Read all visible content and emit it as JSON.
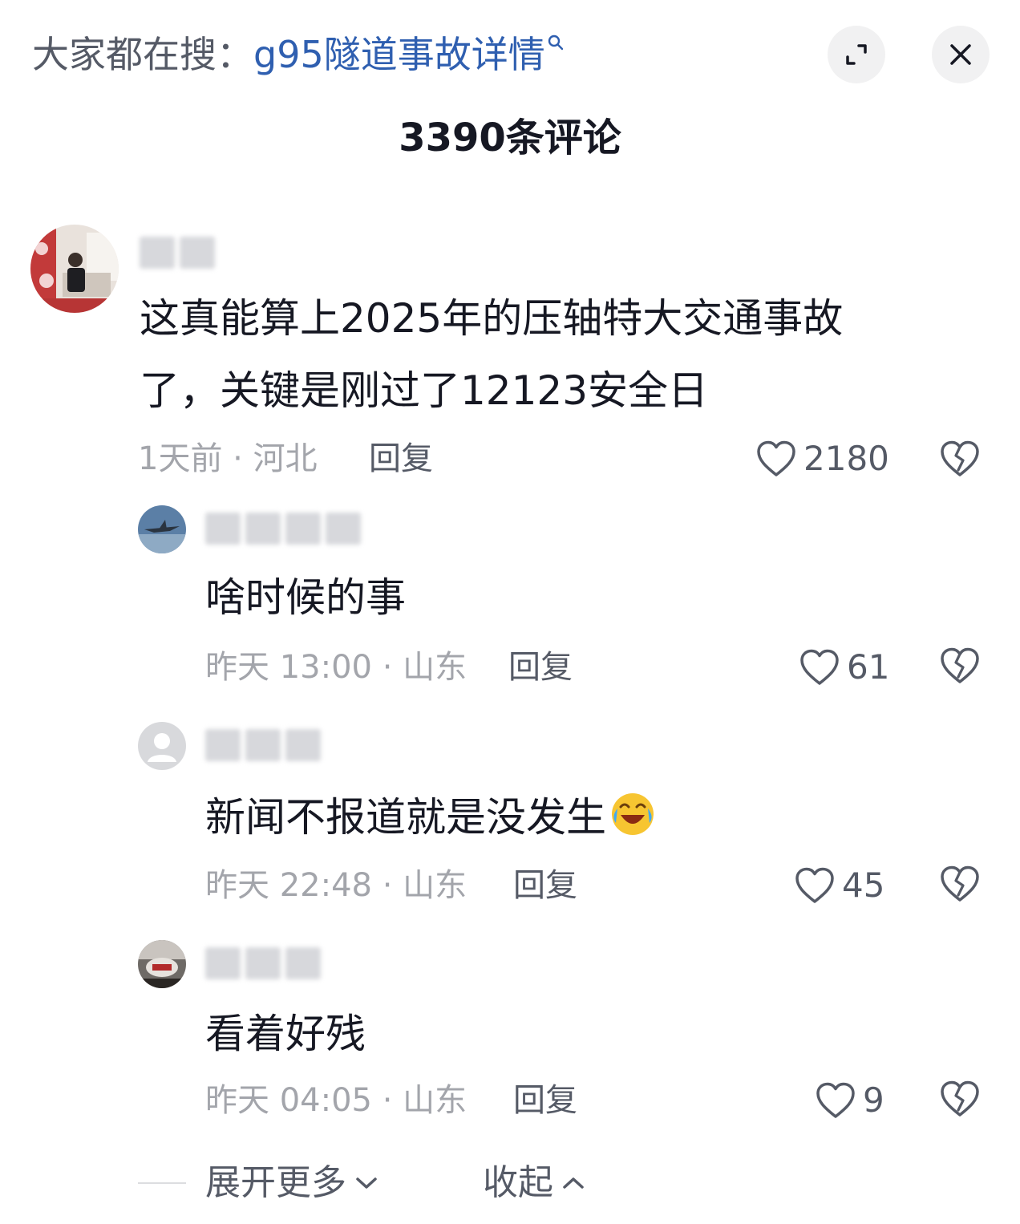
{
  "header": {
    "search_prefix": "大家都在搜：",
    "search_term": "g95隧道事故详情",
    "expand_icon": "expand-icon",
    "close_icon": "close-icon"
  },
  "comment_count": "3390条评论",
  "comments": [
    {
      "avatar": "photo-avatar",
      "content_line1": "这真能算上2025年的压轴特大交通事故",
      "content_line2": "了，关键是刚过了12123安全日",
      "meta": "1天前 · 河北",
      "reply_label": "回复",
      "likes": "2180"
    },
    {
      "avatar": "jet-avatar",
      "content": "啥时候的事",
      "meta": "昨天 13:00 · 山东",
      "reply_label": "回复",
      "likes": "61"
    },
    {
      "avatar": "default-avatar",
      "content": "新闻不报道就是没发生",
      "emoji": "laughing-crying-emoji",
      "meta": "昨天 22:48 · 山东",
      "reply_label": "回复",
      "likes": "45"
    },
    {
      "avatar": "photo-avatar",
      "content": "看着好残",
      "meta": "昨天 04:05 · 山东",
      "reply_label": "回复",
      "likes": "9"
    }
  ],
  "footer": {
    "expand_more": "展开更多",
    "collapse": "收起"
  },
  "colors": {
    "search_term": "#2f5fb0",
    "meta_text": "#a3a5ab",
    "primary_text": "#161823"
  }
}
